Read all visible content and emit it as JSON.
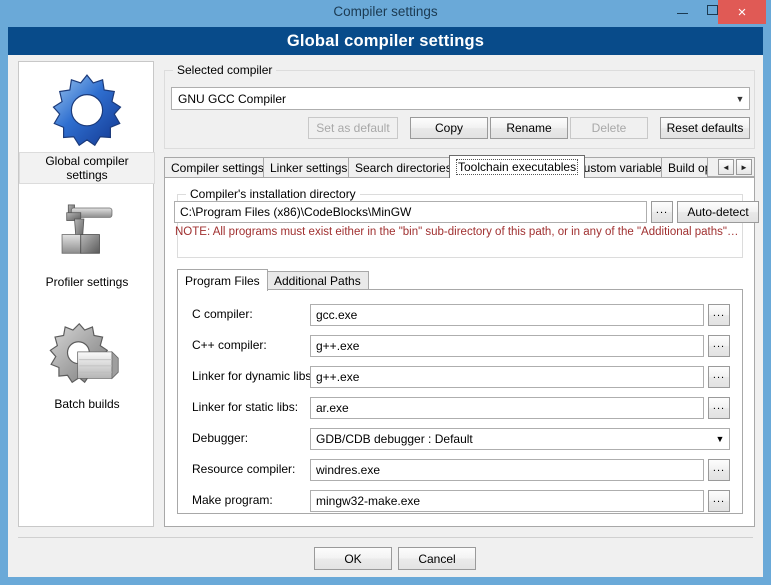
{
  "window": {
    "title": "Compiler settings",
    "header_title": "Global compiler settings",
    "controls": {
      "minimize": "minimize-icon",
      "maximize": "maximize-icon",
      "close": "×"
    },
    "accent_titlebar": "#6aa9d8",
    "accent_header": "#084b8a",
    "accent_close": "#e05a55"
  },
  "sidebar": {
    "items": [
      {
        "label": "Global compiler settings",
        "icon": "blue-gear-icon",
        "selected": true
      },
      {
        "label": "Profiler settings",
        "icon": "gray-wrench-blocks-icon",
        "selected": false
      },
      {
        "label": "Batch builds",
        "icon": "gray-gear-stack-icon",
        "selected": false
      }
    ]
  },
  "selected_compiler": {
    "group_title": "Selected compiler",
    "combo_value": "GNU GCC Compiler",
    "buttons": [
      {
        "label": "Set as default",
        "enabled": false
      },
      {
        "label": "Copy",
        "enabled": true
      },
      {
        "label": "Rename",
        "enabled": true
      },
      {
        "label": "Delete",
        "enabled": false
      },
      {
        "label": "Reset defaults",
        "enabled": true
      }
    ]
  },
  "tabs": {
    "items": [
      {
        "label": "Compiler settings",
        "active": false
      },
      {
        "label": "Linker settings",
        "active": false
      },
      {
        "label": "Search directories",
        "active": false
      },
      {
        "label": "Toolchain executables",
        "active": true
      },
      {
        "label": "Custom variables",
        "active": false
      },
      {
        "label": "Build options",
        "active": false
      }
    ],
    "scroll_left": "◄",
    "scroll_right": "►"
  },
  "install_dir": {
    "group_title": "Compiler's installation directory",
    "value": "C:\\Program Files (x86)\\CodeBlocks\\MinGW",
    "browse_label": "...",
    "autodetect_label": "Auto-detect",
    "note": "NOTE: All programs must exist either in the \"bin\" sub-directory of this path, or in any of the \"Additional paths\"…",
    "note_color": "#a03030"
  },
  "inner_tabs": {
    "items": [
      {
        "label": "Program Files",
        "active": true
      },
      {
        "label": "Additional Paths",
        "active": false
      }
    ]
  },
  "program_files": {
    "browse_label": "...",
    "rows": [
      {
        "label": "C compiler:",
        "value": "gcc.exe",
        "type": "text"
      },
      {
        "label": "C++ compiler:",
        "value": "g++.exe",
        "type": "text"
      },
      {
        "label": "Linker for dynamic libs:",
        "value": "g++.exe",
        "type": "text"
      },
      {
        "label": "Linker for static libs:",
        "value": "ar.exe",
        "type": "text"
      },
      {
        "label": "Debugger:",
        "value": "GDB/CDB debugger : Default",
        "type": "combo"
      },
      {
        "label": "Resource compiler:",
        "value": "windres.exe",
        "type": "text"
      },
      {
        "label": "Make program:",
        "value": "mingw32-make.exe",
        "type": "text"
      }
    ]
  },
  "footer": {
    "ok_label": "OK",
    "cancel_label": "Cancel"
  }
}
